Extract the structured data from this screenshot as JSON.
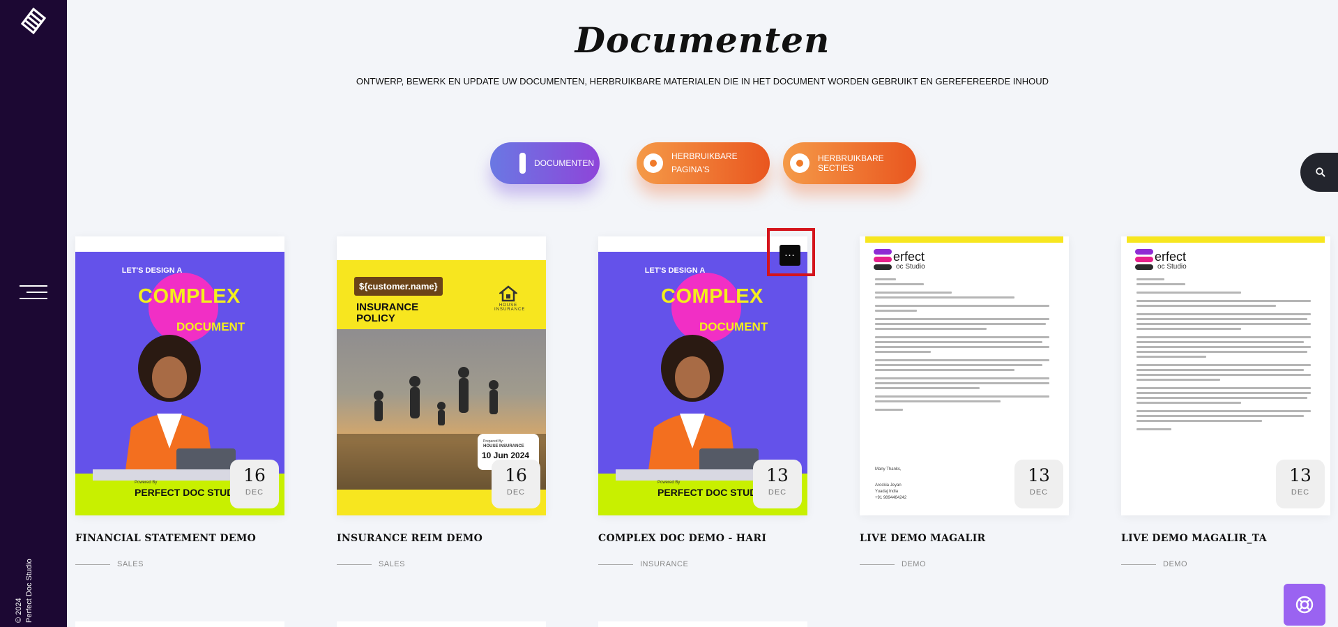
{
  "sidebar": {
    "copyright_line1": "© 2024",
    "copyright_line2": "Perfect Doc Studio"
  },
  "header": {
    "title": "Documenten",
    "subtitle": "ONTWERP, BEWERK EN UPDATE UW DOCUMENTEN, HERBRUIKBARE MATERIALEN DIE IN HET DOCUMENT WORDEN GEBRUIKT EN GEREFEREERDE INHOUD"
  },
  "tabs": [
    {
      "label": "DOCUMENTEN",
      "active": true
    },
    {
      "label": "HERBRUIKBARE PAGINA'S",
      "active": false
    },
    {
      "label": "HERBRUIKBARE SECTIES",
      "active": false
    }
  ],
  "icons": {
    "search": "search-icon",
    "menu": "hamburger-menu-icon",
    "help": "lifebuoy-icon",
    "more": "more-options-icon",
    "logo": "logo-icon"
  },
  "colors": {
    "sidebar": "#1c0833",
    "active_tab": "#7b5ee0",
    "inactive_tab": "#ee6a2c",
    "help": "#9a63f1",
    "highlight": "#d4141c"
  },
  "cards": [
    {
      "title": "FINANCIAL STATEMENT DEMO",
      "category": "SALES",
      "day": "16",
      "month": "DEC",
      "thumb": {
        "line1": "LET'S DESIGN A",
        "line2": "COMPLEX",
        "line3": "DOCUMENT",
        "powered": "Powered By",
        "brand": "PERFECT DOC STUDIO"
      }
    },
    {
      "title": "INSURANCE REIM DEMO",
      "category": "SALES",
      "day": "16",
      "month": "DEC",
      "thumb": {
        "tag": "${customer.name}",
        "line1": "INSURANCE",
        "line2": "POLICY",
        "house": "HOUSE",
        "insurance_small": "INSURANCE",
        "prepared": "Prepared By:",
        "company": "HOUSE INSURANCE",
        "date": "10 Jun 2024"
      }
    },
    {
      "title": "COMPLEX DOC DEMO - HARI",
      "category": "INSURANCE",
      "day": "13",
      "month": "DEC",
      "thumb": {
        "line1": "LET'S DESIGN A",
        "line2": "COMPLEX",
        "line3": "DOCUMENT",
        "powered": "Powered By",
        "brand": "PERFECT DOC STUDIO"
      }
    },
    {
      "title": "LIVE DEMO MAGALIR",
      "category": "DEMO",
      "day": "13",
      "month": "DEC",
      "thumb": {
        "brand1": "erfect",
        "brand2": "oc Studio",
        "sig1": "Many Thanks,",
        "sig2": "Arockia Jeyan",
        "sig3": "Yuadaj India",
        "sig4": "+91 9894464242"
      }
    },
    {
      "title": "LIVE DEMO MAGALIR_TA",
      "category": "DEMO",
      "day": "13",
      "month": "DEC",
      "thumb": {
        "brand1": "erfect",
        "brand2": "oc Studio"
      }
    }
  ]
}
